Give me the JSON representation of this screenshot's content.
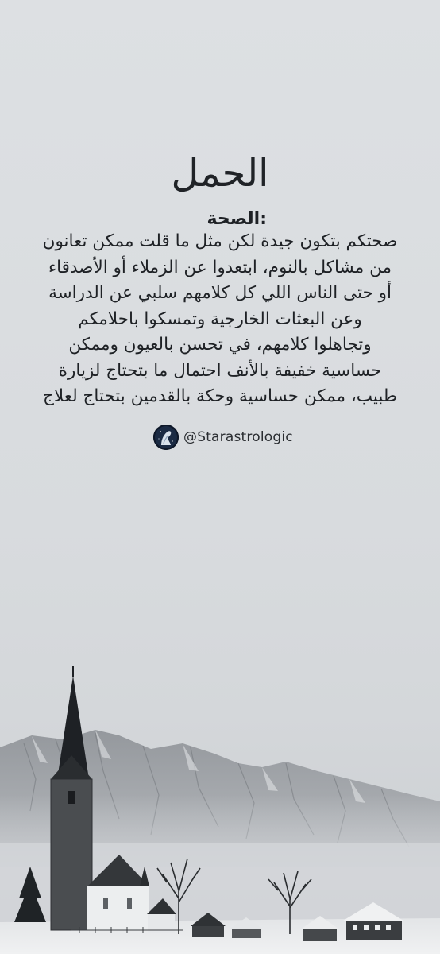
{
  "title": "الحمل",
  "section_label": ":الصحة",
  "body_lines": [
    "صحتكم بتكون جيدة لكن مثل ما قلت ممكن تعانون",
    "من مشاكل بالنوم، ابتعدوا عن الزملاء أو الأصدقاء",
    "أو حتى الناس اللي كل كلامهم سلبي عن الدراسة",
    "وعن البعثات الخارجية وتمسكوا باحلامكم",
    "وتجاهلوا كلامهم، في تحسن بالعيون وممكن",
    "حساسية خفيفة بالأنف احتمال ما بتحتاج لزيارة",
    "طبيب، ممكن حساسية وحكة بالقدمين بتحتاج لعلاج"
  ],
  "handle": "@Starastrologic",
  "colors": {
    "background": "#dcdfe2",
    "text": "#1f2226"
  },
  "icons": {
    "avatar": "astrology-avatar-icon"
  }
}
